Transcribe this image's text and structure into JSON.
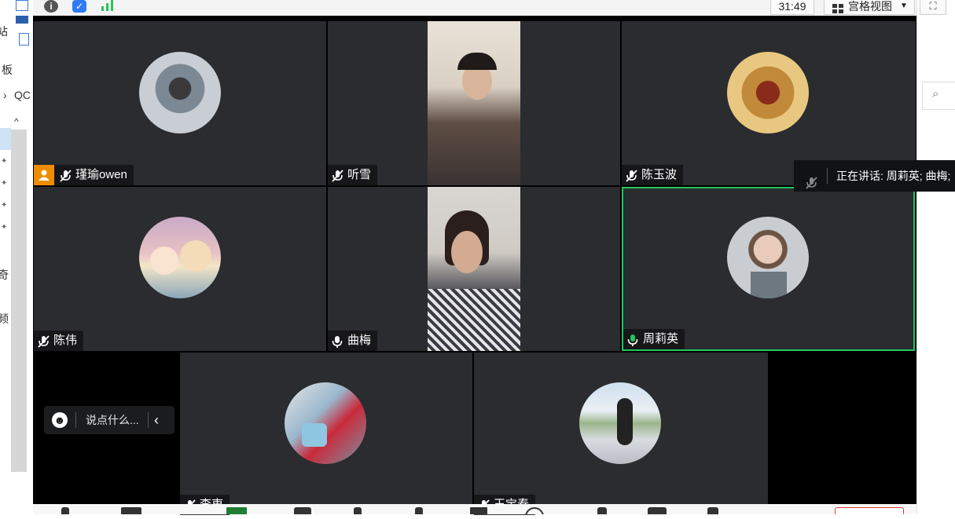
{
  "background_app": {
    "left_texts": [
      "站",
      "板",
      "QC",
      "奇",
      "频"
    ],
    "left_chevron": "›",
    "scroll_up": "^",
    "right_search_icon": "search-icon"
  },
  "toolbar": {
    "timer": "31:49",
    "view_label": "宫格视图",
    "view_arrow": "▼",
    "fullscreen_glyph": "⛶"
  },
  "participants": [
    {
      "name": "瑾瑜owen",
      "muted": true,
      "host": true,
      "media": "avatar"
    },
    {
      "name": "听雪",
      "muted": true,
      "media": "video"
    },
    {
      "name": "陈玉波",
      "muted": true,
      "media": "avatar"
    },
    {
      "name": "陈伟",
      "muted": true,
      "media": "avatar"
    },
    {
      "name": "曲梅",
      "muted": false,
      "media": "video"
    },
    {
      "name": "周莉英",
      "muted": false,
      "speaking": true,
      "media": "avatar"
    },
    {
      "name": "李東",
      "muted": true,
      "media": "avatar"
    },
    {
      "name": "王宝春",
      "muted": true,
      "media": "avatar"
    }
  ],
  "speaking_toast": {
    "text": "正在讲话: 周莉英; 曲梅;"
  },
  "chat": {
    "placeholder": "说点什么...",
    "collapse_glyph": "‹"
  },
  "colors": {
    "tile_bg": "#2a2c2f",
    "active_border": "#22c55e",
    "host_badge": "#f08c00",
    "mic_muted": "#ffffff",
    "mic_active": "#22c55e"
  }
}
